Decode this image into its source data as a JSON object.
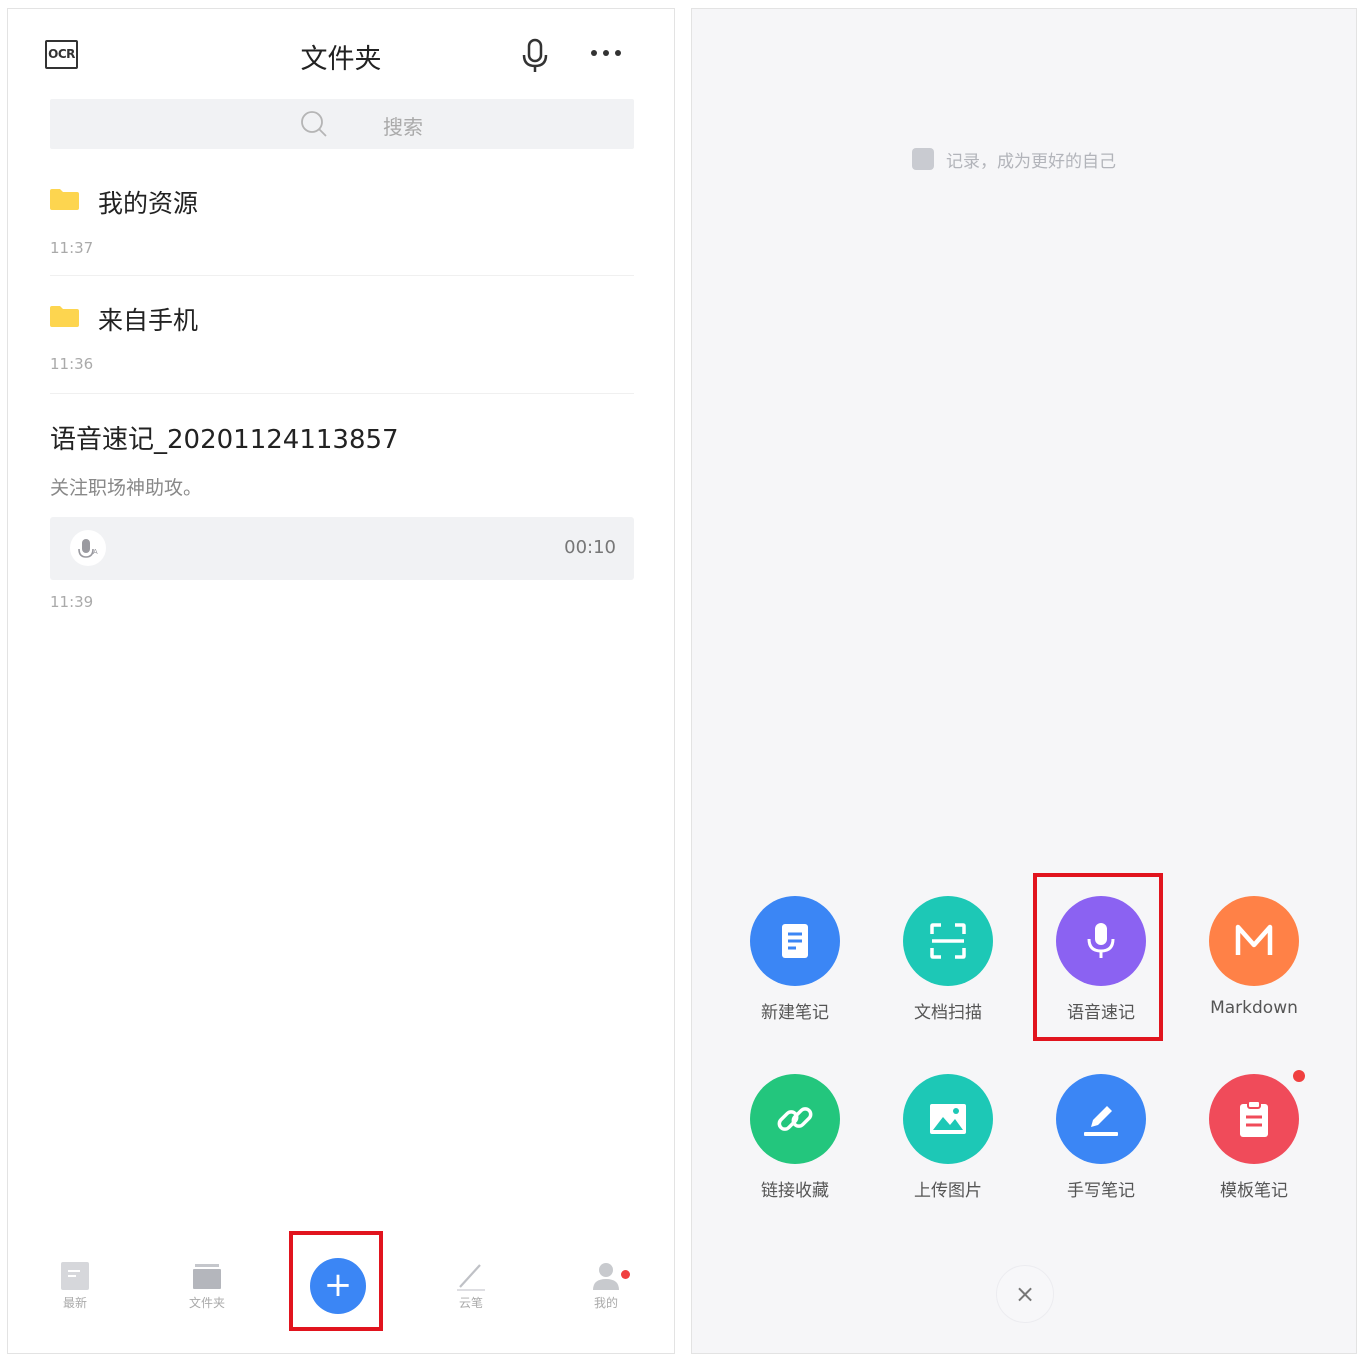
{
  "left": {
    "ocr_label": "OCR",
    "title": "文件夹",
    "search_placeholder": "搜索",
    "folders": [
      {
        "name": "我的资源",
        "time": "11:37"
      },
      {
        "name": "来自手机",
        "time": "11:36"
      }
    ],
    "note": {
      "title": "语音速记_20201124113857",
      "desc": "关注职场神助攻。",
      "duration": "00:10",
      "time": "11:39"
    },
    "tabs": [
      {
        "label": "最新",
        "icon": "latest-icon"
      },
      {
        "label": "文件夹",
        "icon": "folder-icon"
      },
      {
        "label": "云笔",
        "icon": "pen-icon"
      },
      {
        "label": "我的",
        "icon": "user-icon"
      }
    ],
    "add_symbol": "+",
    "highlight_color": "#e1141e",
    "accent_color": "#3b86f5"
  },
  "right": {
    "slogan": "记录，成为更好的自己",
    "actions": [
      {
        "label": "新建笔记",
        "icon": "document-icon",
        "color": "#3b86f5"
      },
      {
        "label": "文档扫描",
        "icon": "scan-icon",
        "color": "#1dc8b6"
      },
      {
        "label": "语音速记",
        "icon": "microphone-icon",
        "color": "#8b62f2"
      },
      {
        "label": "Markdown",
        "icon": "markdown-icon",
        "color": "#ff8147"
      },
      {
        "label": "链接收藏",
        "icon": "link-icon",
        "color": "#23c67d"
      },
      {
        "label": "上传图片",
        "icon": "image-icon",
        "color": "#1dc8b6"
      },
      {
        "label": "手写笔记",
        "icon": "handwrite-icon",
        "color": "#3b86f5"
      },
      {
        "label": "模板笔记",
        "icon": "template-icon",
        "color": "#f04b5a"
      }
    ],
    "close_symbol": "×"
  }
}
